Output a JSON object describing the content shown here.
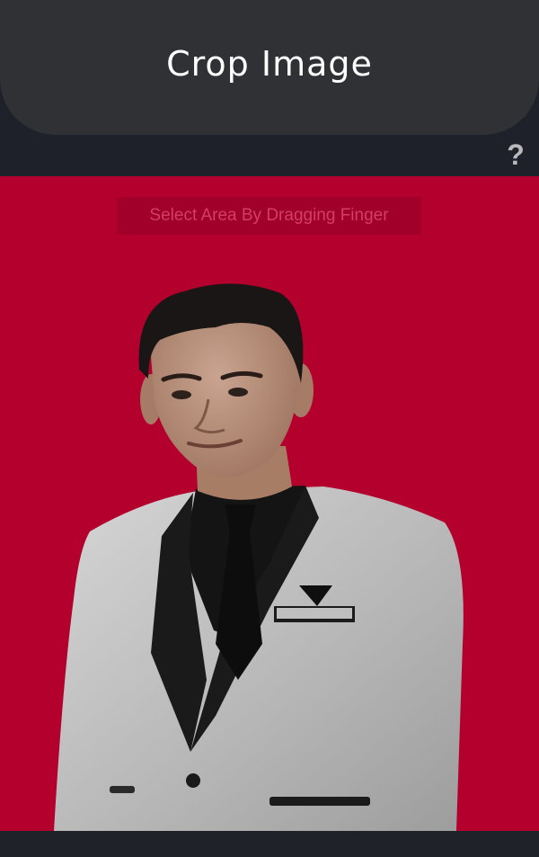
{
  "header": {
    "title": "Crop Image"
  },
  "help": {
    "label": "?"
  },
  "canvas": {
    "hint": "Select Area By Dragging Finger"
  },
  "colors": {
    "header_bg": "#303135",
    "page_bg": "#1f212a",
    "canvas_bg": "#b4002d",
    "hint_bg": "#a1002a",
    "hint_text": "#d33e63"
  },
  "icons": {
    "help": "question-mark-icon"
  }
}
